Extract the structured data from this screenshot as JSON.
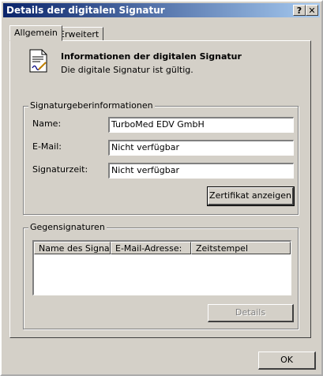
{
  "window": {
    "title": "Details der digitalen Signatur",
    "help_glyph": "?",
    "close_glyph": "✕"
  },
  "tabs": [
    {
      "label": "Allgemein",
      "selected": true
    },
    {
      "label": "Erweitert",
      "selected": false
    }
  ],
  "info": {
    "heading": "Informationen der digitalen Signatur",
    "status": "Die digitale Signatur ist gültig."
  },
  "signer_group": {
    "label": "Signaturgeberinformationen",
    "fields": [
      {
        "label": "Name:",
        "value": "TurboMed EDV GmbH"
      },
      {
        "label": "E-Mail:",
        "value": "Nicht verfügbar"
      },
      {
        "label": "Signaturzeit:",
        "value": "Nicht verfügbar"
      }
    ],
    "view_certificate": "Zertifikat anzeigen"
  },
  "countersign_group": {
    "label": "Gegensignaturen",
    "columns": [
      "Name des Signa...",
      "E-Mail-Adresse:",
      "Zeitstempel"
    ],
    "details_button": "Details"
  },
  "ok_button": "OK",
  "colors": {
    "face": "#d4d0c8",
    "title_start": "#0a246a",
    "title_end": "#a6caf0"
  }
}
